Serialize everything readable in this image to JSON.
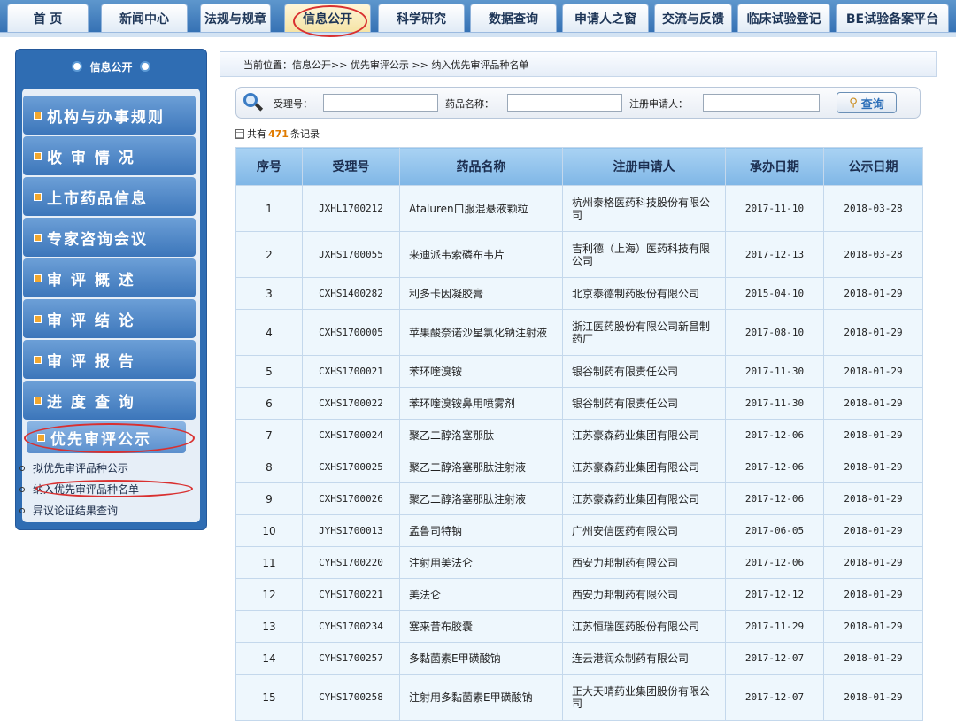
{
  "nav": {
    "tabs": [
      "首 页",
      "新闻中心",
      "法规与规章",
      "信息公开",
      "科学研究",
      "数据查询",
      "申请人之窗",
      "交流与反馈",
      "临床试验登记",
      "BE试验备案平台"
    ],
    "active": "信息公开"
  },
  "sidebar": {
    "title": "信息公开",
    "items": [
      "机构与办事规则",
      "收 审 情 况",
      "上市药品信息",
      "专家咨询会议",
      "审 评 概 述",
      "审 评 结 论",
      "审 评 报 告",
      "进 度 查 询",
      "优先审评公示"
    ],
    "selected": "优先审评公示",
    "subitems": [
      "拟优先审评品种公示",
      "纳入优先审评品种名单",
      "异议论证结果查询"
    ]
  },
  "breadcrumb": "当前位置：信息公开>> 优先审评公示 >> 纳入优先审评品种名单",
  "search": {
    "accept_label": "受理号：",
    "drug_label": "药品名称：",
    "applicant_label": "注册申请人：",
    "accept_value": "",
    "drug_value": "",
    "applicant_value": "",
    "button": "查询"
  },
  "count": {
    "prefix": "共有",
    "number": "471",
    "suffix": "条记录"
  },
  "table": {
    "headers": [
      "序号",
      "受理号",
      "药品名称",
      "注册申请人",
      "承办日期",
      "公示日期"
    ],
    "rows": [
      [
        "1",
        "JXHL1700212",
        "Ataluren口服混悬液颗粒",
        "杭州泰格医药科技股份有限公司",
        "2017-11-10",
        "2018-03-28"
      ],
      [
        "2",
        "JXHS1700055",
        "来迪派韦索磷布韦片",
        "吉利德（上海）医药科技有限公司",
        "2017-12-13",
        "2018-03-28"
      ],
      [
        "3",
        "CXHS1400282",
        "利多卡因凝胶膏",
        "北京泰德制药股份有限公司",
        "2015-04-10",
        "2018-01-29"
      ],
      [
        "4",
        "CXHS1700005",
        "苹果酸奈诺沙星氯化钠注射液",
        "浙江医药股份有限公司新昌制药厂",
        "2017-08-10",
        "2018-01-29"
      ],
      [
        "5",
        "CXHS1700021",
        "苯环喹溴铵",
        "银谷制药有限责任公司",
        "2017-11-30",
        "2018-01-29"
      ],
      [
        "6",
        "CXHS1700022",
        "苯环喹溴铵鼻用喷雾剂",
        "银谷制药有限责任公司",
        "2017-11-30",
        "2018-01-29"
      ],
      [
        "7",
        "CXHS1700024",
        "聚乙二醇洛塞那肽",
        "江苏豪森药业集团有限公司",
        "2017-12-06",
        "2018-01-29"
      ],
      [
        "8",
        "CXHS1700025",
        "聚乙二醇洛塞那肽注射液",
        "江苏豪森药业集团有限公司",
        "2017-12-06",
        "2018-01-29"
      ],
      [
        "9",
        "CXHS1700026",
        "聚乙二醇洛塞那肽注射液",
        "江苏豪森药业集团有限公司",
        "2017-12-06",
        "2018-01-29"
      ],
      [
        "10",
        "JYHS1700013",
        "孟鲁司特钠",
        "广州安信医药有限公司",
        "2017-06-05",
        "2018-01-29"
      ],
      [
        "11",
        "CYHS1700220",
        "注射用美法仑",
        "西安力邦制药有限公司",
        "2017-12-06",
        "2018-01-29"
      ],
      [
        "12",
        "CYHS1700221",
        "美法仑",
        "西安力邦制药有限公司",
        "2017-12-12",
        "2018-01-29"
      ],
      [
        "13",
        "CYHS1700234",
        "塞来昔布胶囊",
        "江苏恒瑞医药股份有限公司",
        "2017-11-29",
        "2018-01-29"
      ],
      [
        "14",
        "CYHS1700257",
        "多黏菌素E甲磺酸钠",
        "连云港润众制药有限公司",
        "2017-12-07",
        "2018-01-29"
      ],
      [
        "15",
        "CYHS1700258",
        "注射用多黏菌素E甲磺酸钠",
        "正大天晴药业集团股份有限公司",
        "2017-12-07",
        "2018-01-29"
      ]
    ]
  },
  "colors": {
    "nav": "#2f6bb0",
    "sidebar": "#2f6db3",
    "header_row": "#8fc0ea",
    "row_bg": "#eef7fd",
    "highlight": "#d93030",
    "count": "#e07b00"
  }
}
